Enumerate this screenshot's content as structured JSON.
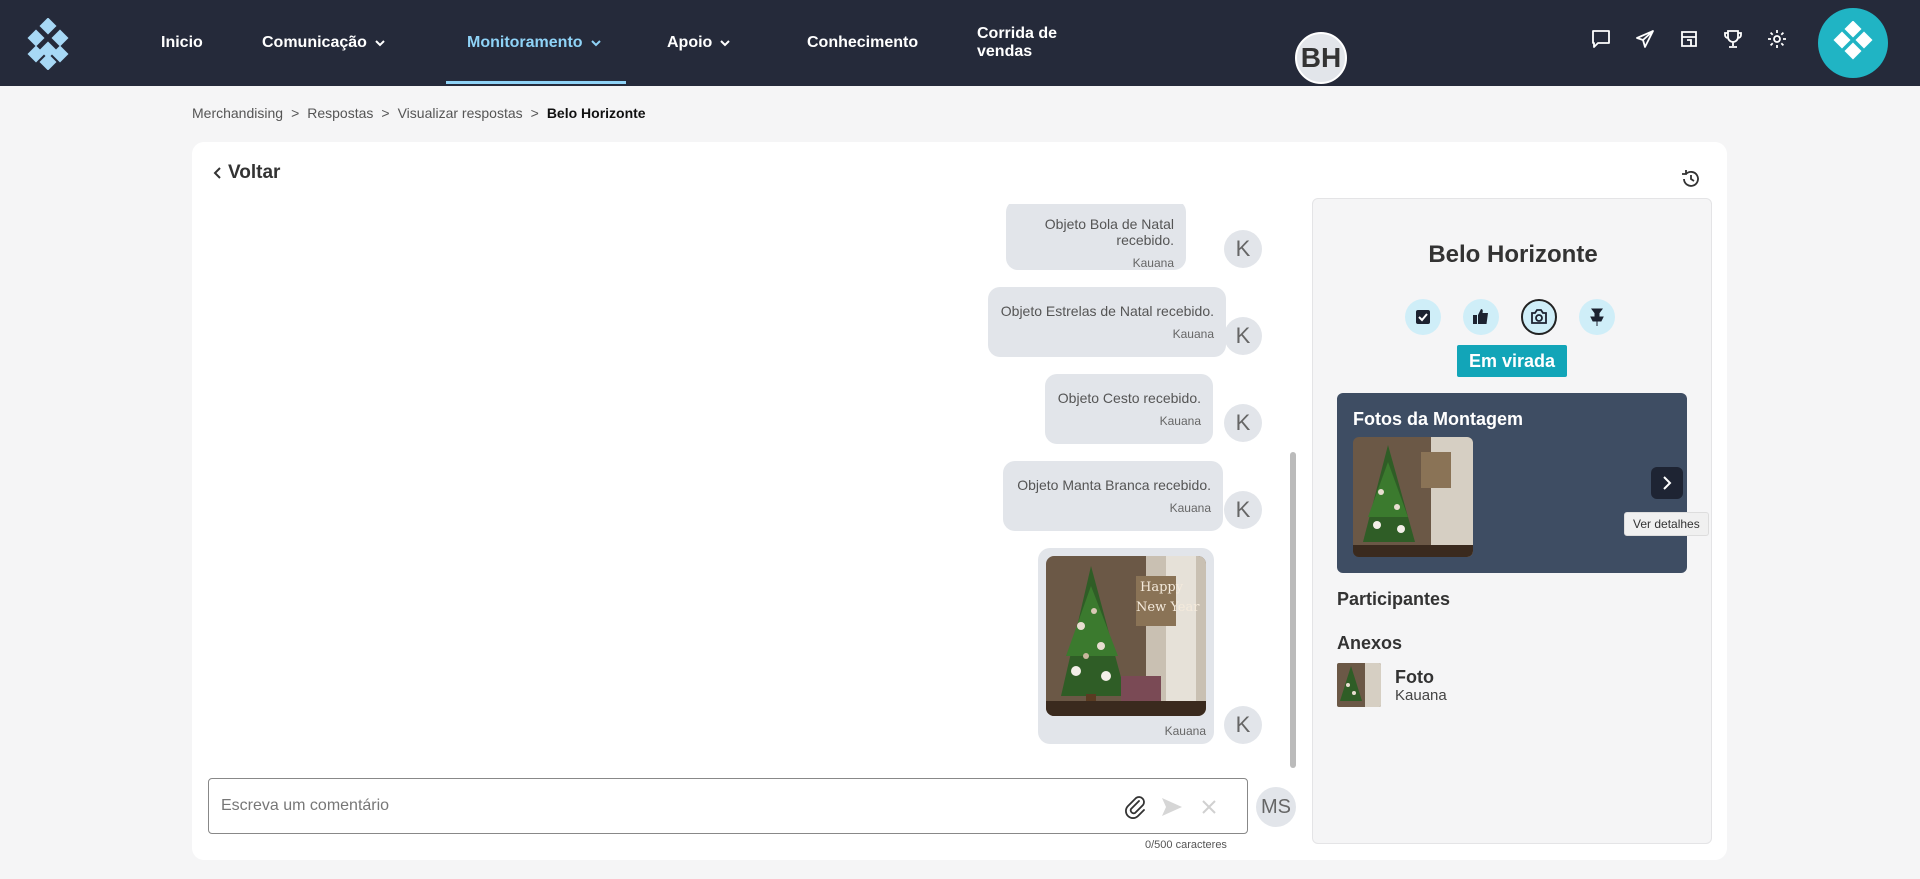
{
  "nav": {
    "items": [
      {
        "label": "Inicio",
        "has_chevron": false,
        "active": false
      },
      {
        "label": "Comunicação",
        "has_chevron": true,
        "active": false
      },
      {
        "label": "Monitoramento",
        "has_chevron": true,
        "active": true
      },
      {
        "label": "Apoio",
        "has_chevron": true,
        "active": false
      },
      {
        "label": "Conhecimento",
        "has_chevron": true,
        "active": false
      },
      {
        "label": "Corrida de vendas",
        "has_chevron": false,
        "active": false
      }
    ],
    "icons": [
      "chat-icon",
      "send-icon",
      "store-icon",
      "trophy-icon",
      "gear-icon"
    ]
  },
  "breadcrumb": {
    "items": [
      "Merchandising",
      "Respostas",
      "Visualizar respostas"
    ],
    "separator": ">",
    "current": "Belo Horizonte"
  },
  "back_label": "Voltar",
  "messages": [
    {
      "text": "Objeto Bola de Natal recebido.",
      "author": "Kauana",
      "avatar": "K"
    },
    {
      "text": "Objeto Estrelas de Natal recebido.",
      "author": "Kauana",
      "avatar": "K"
    },
    {
      "text": "Objeto Cesto recebido.",
      "author": "Kauana",
      "avatar": "K"
    },
    {
      "text": "Objeto Manta Branca recebido.",
      "author": "Kauana",
      "avatar": "K"
    },
    {
      "image": "christmas-tree-photo",
      "author": "Kauana",
      "avatar": "K"
    }
  ],
  "comment": {
    "placeholder": "Escreva um comentário",
    "value": "",
    "counter": "0/500 caracteres",
    "user_initials": "MS"
  },
  "panel": {
    "initials": "BH",
    "title": "Belo Horizonte",
    "status_icons": [
      "checkbox-icon",
      "thumbs-up-icon",
      "camera-icon",
      "flag-icon"
    ],
    "selected_status": "camera-icon",
    "badge": "Em virada",
    "photos_title": "Fotos da Montagem",
    "tooltip": "Ver detalhes",
    "participants_label": "Participantes",
    "attachments_label": "Anexos",
    "attachment": {
      "name": "Foto",
      "author": "Kauana"
    }
  },
  "colors": {
    "topbar": "#252a3a",
    "active_nav": "#8fd3f7",
    "brand": "#20b4c4",
    "badge": "#12a5b8",
    "photos_box": "#3e4d63"
  }
}
